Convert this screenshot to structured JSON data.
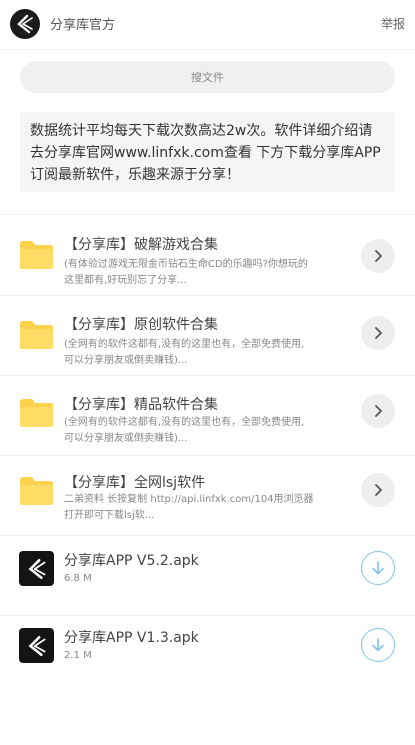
{
  "header": {
    "title": "分享库官方",
    "report": "举报"
  },
  "search": {
    "placeholder": "搜文件"
  },
  "notice": {
    "text": "数据统计平均每天下载次数高达2w次。软件详细介绍请去分享库官网www.linfxk.com查看 下方下载分享库APP订阅最新软件，乐趣来源于分享！"
  },
  "folders": [
    {
      "title": "【分享库】破解游戏合集",
      "desc": "(有体验过游戏无限金币钻石生命CD的乐趣吗?你想玩的这里都有,好玩别忘了分享..."
    },
    {
      "title": "【分享库】原创软件合集",
      "desc": "(全网有的软件这都有,没有的这里也有，全部免费使用,可以分享朋友或倒卖赚钱)..."
    },
    {
      "title": "【分享库】精品软件合集",
      "desc": "(全网有的软件这都有,没有的这里也有，全部免费使用,可以分享朋友或倒卖赚钱)..."
    },
    {
      "title": "【分享库】全网lsj软件",
      "desc": "二弟资料 长按复制 http://api.linfxk.com/104用浏览器打开即可下载lsj软..."
    }
  ],
  "files": [
    {
      "name": "分享库APP V5.2.apk",
      "size": "6.8 M"
    },
    {
      "name": "分享库APP V1.3.apk",
      "size": "2.1 M"
    }
  ],
  "colors": {
    "folder": "#ffd24d",
    "download_accent": "#7fc4ea",
    "chevron_bg": "#eeeeee"
  },
  "icons": {
    "logo": "share-library-logo-icon",
    "folder": "folder-icon",
    "chevron": "chevron-right-icon",
    "download": "download-arrow-icon"
  }
}
